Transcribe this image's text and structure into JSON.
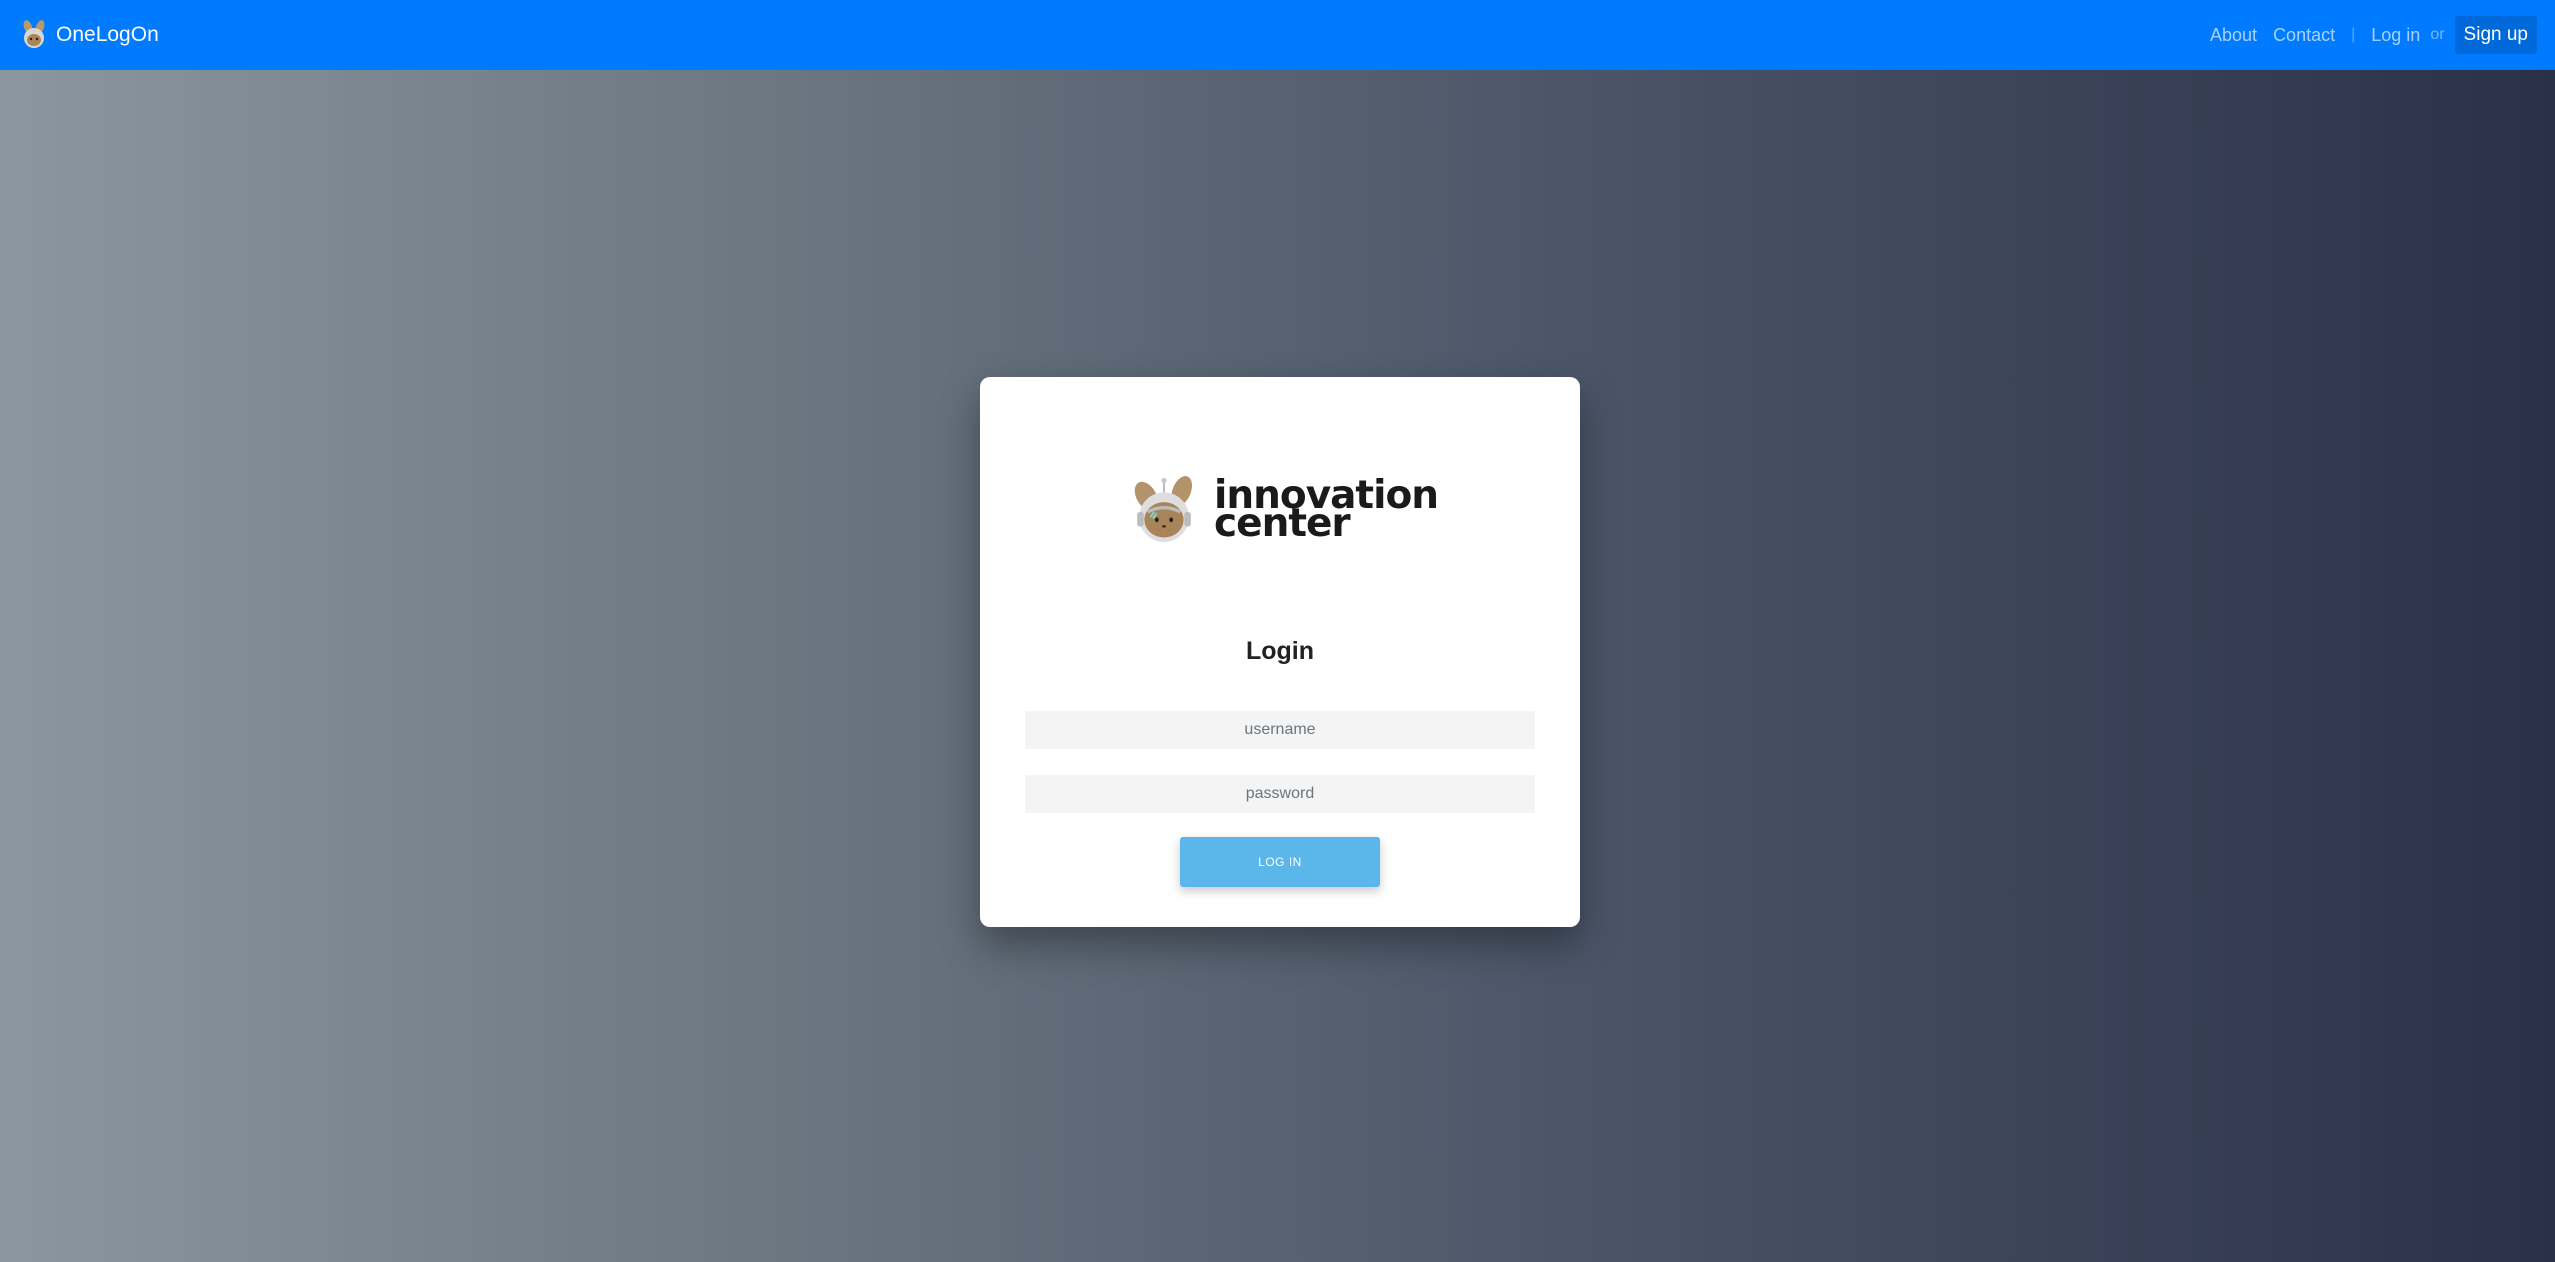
{
  "navbar": {
    "brand": "OneLogOn",
    "links": [
      "About",
      "Contact",
      "Log in"
    ],
    "separator": "|",
    "or_text": "or",
    "signup": "Sign up",
    "color": "#007bff"
  },
  "card": {
    "logo": {
      "line1": "innovation",
      "line2": "center",
      "icon": "bunny-astronaut-logo"
    },
    "title": "Login",
    "username_placeholder": "username",
    "password_placeholder": "password",
    "login_button": "LOG IN",
    "button_color": "#5bb6ea"
  }
}
